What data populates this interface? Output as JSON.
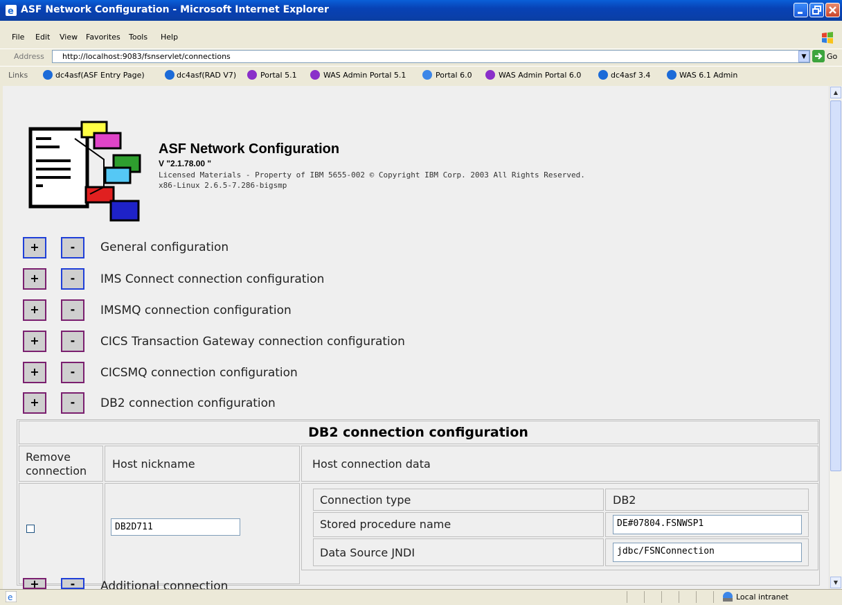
{
  "window": {
    "title": "ASF Network Configuration - Microsoft Internet Explorer"
  },
  "menu": [
    "File",
    "Edit",
    "View",
    "Favorites",
    "Tools",
    "Help"
  ],
  "address": {
    "label": "Address",
    "url": "http://localhost:9083/fsnservlet/connections",
    "go_label": "Go"
  },
  "links": {
    "label": "Links",
    "items": [
      "dc4asf(ASF Entry Page)",
      "dc4asf(RAD V7)",
      "Portal 5.1",
      "WAS Admin Portal 5.1",
      "Portal 6.0",
      "WAS Admin Portal 6.0",
      "dc4asf 3.4",
      "WAS 6.1 Admin"
    ]
  },
  "header": {
    "title": "ASF Network Configuration",
    "version": "V \"2.1.78.00 \"",
    "license": "Licensed Materials - Property of IBM 5655-002 © Copyright IBM Corp. 2003 All Rights Reserved.",
    "os": "x86-Linux 2.6.5-7.286-bigsmp"
  },
  "sections": [
    {
      "label": "General configuration",
      "plus": "+",
      "minus": "-"
    },
    {
      "label": "IMS Connect connection configuration",
      "plus": "+",
      "minus": "-"
    },
    {
      "label": "IMSMQ connection configuration",
      "plus": "+",
      "minus": "-"
    },
    {
      "label": "CICS Transaction Gateway connection configuration",
      "plus": "+",
      "minus": "-"
    },
    {
      "label": "CICSMQ connection configuration",
      "plus": "+",
      "minus": "-"
    },
    {
      "label": "DB2 connection configuration",
      "plus": "+",
      "minus": "-"
    },
    {
      "label": "Additional connection",
      "plus": "+",
      "minus": "-"
    }
  ],
  "db2_panel": {
    "title": "DB2 connection configuration",
    "col_remove_line1": "Remove",
    "col_remove_line2": "connection",
    "col_nickname": "Host nickname",
    "col_data": "Host connection data",
    "nickname_value": "DB2D711",
    "conn_type_label": "Connection type",
    "conn_type_value": "DB2",
    "sp_label": "Stored procedure name",
    "sp_value": "DE#07804.FSNWSP1",
    "jndi_label": "Data Source JNDI",
    "jndi_value": "jdbc/FSNConnection"
  },
  "status": {
    "zone": "Local intranet"
  }
}
